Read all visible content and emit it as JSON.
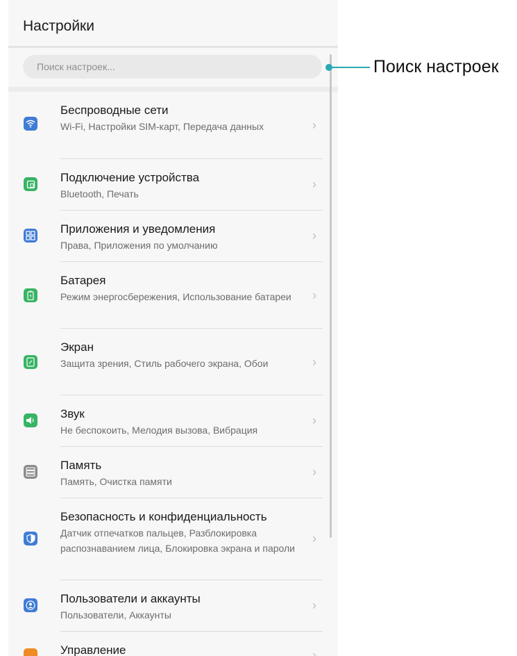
{
  "header": {
    "title": "Настройки"
  },
  "search": {
    "placeholder": "Поиск настроек..."
  },
  "callout": {
    "label": "Поиск настроек"
  },
  "items": [
    {
      "title": "Беспроводные сети",
      "subtitle": "Wi-Fi, Настройки SIM-карт, Передача данных",
      "icon": "wifi-icon",
      "color": "#3f7cd6"
    },
    {
      "title": "Подключение устройства",
      "subtitle": "Bluetooth, Печать",
      "icon": "device-connection-icon",
      "color": "#37b464"
    },
    {
      "title": "Приложения и уведомления",
      "subtitle": "Права, Приложения по умолчанию",
      "icon": "apps-grid-icon",
      "color": "#3f7cd6"
    },
    {
      "title": "Батарея",
      "subtitle": "Режим энергосбережения, Использование батареи",
      "icon": "battery-icon",
      "color": "#37b464"
    },
    {
      "title": "Экран",
      "subtitle": "Защита зрения, Стиль рабочего экрана, Обои",
      "icon": "display-icon",
      "color": "#37b464"
    },
    {
      "title": "Звук",
      "subtitle": "Не беспокоить, Мелодия вызова, Вибрация",
      "icon": "speaker-icon",
      "color": "#37b464"
    },
    {
      "title": "Память",
      "subtitle": "Память, Очистка памяти",
      "icon": "storage-icon",
      "color": "#8c8c8c"
    },
    {
      "title": "Безопасность и конфиденциальность",
      "subtitle": "Датчик отпечатков пальцев, Разблокировка распознаванием лица, Блокировка экрана и пароли",
      "icon": "shield-icon",
      "color": "#3f7cd6"
    },
    {
      "title": "Пользователи и аккаунты",
      "subtitle": "Пользователи, Аккаунты",
      "icon": "user-icon",
      "color": "#3f7cd6"
    },
    {
      "title": "Управление",
      "subtitle": "",
      "icon": "management-icon",
      "color": "#f08a24"
    }
  ]
}
